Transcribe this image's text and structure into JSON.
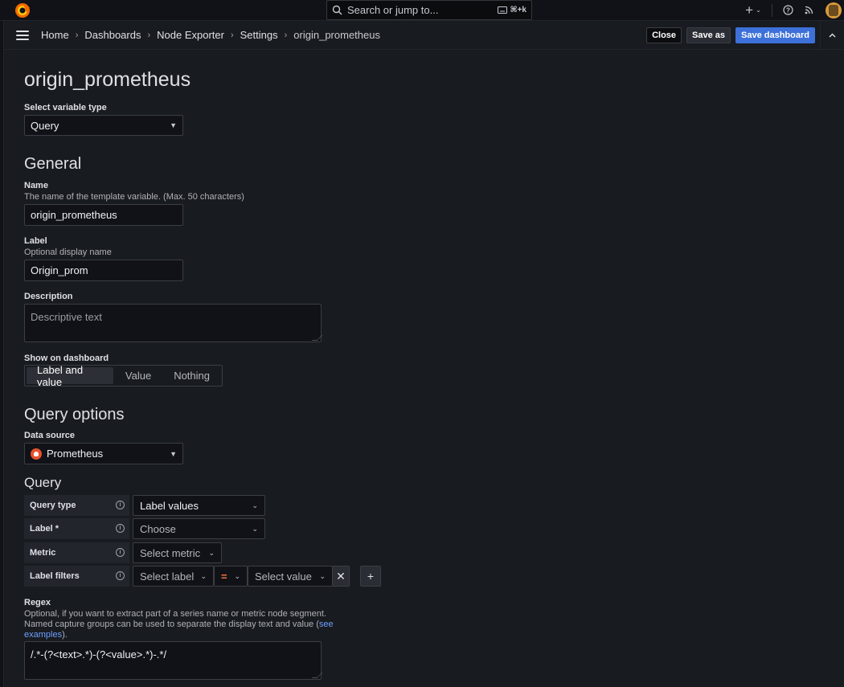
{
  "search": {
    "placeholder": "Search or jump to...",
    "shortcut": "⌘+k"
  },
  "topbar": {
    "add_icon": "plus-icon",
    "help_icon": "help-icon",
    "news_icon": "rss-icon"
  },
  "breadcrumb": [
    "Home",
    "Dashboards",
    "Node Exporter",
    "Settings",
    "origin_prometheus"
  ],
  "toolbar": {
    "close_label": "Close",
    "save_as_label": "Save as",
    "save_dashboard_label": "Save dashboard"
  },
  "page": {
    "title": "origin_prometheus"
  },
  "variable_type": {
    "label": "Select variable type",
    "value": "Query"
  },
  "general": {
    "heading": "General",
    "name": {
      "label": "Name",
      "description": "The name of the template variable. (Max. 50 characters)",
      "value": "origin_prometheus"
    },
    "display_label": {
      "label": "Label",
      "description": "Optional display name",
      "value": "Origin_prom"
    },
    "description": {
      "label": "Description",
      "placeholder": "Descriptive text"
    },
    "show_on_dashboard": {
      "label": "Show on dashboard",
      "options": [
        "Label and value",
        "Value",
        "Nothing"
      ],
      "selected": "Label and value"
    }
  },
  "query_options": {
    "heading": "Query options",
    "data_source": {
      "label": "Data source",
      "value": "Prometheus"
    }
  },
  "query": {
    "heading": "Query",
    "query_type": {
      "label": "Query type",
      "value": "Label values"
    },
    "label": {
      "label": "Label *",
      "placeholder": "Choose"
    },
    "metric": {
      "label": "Metric",
      "placeholder": "Select metric"
    },
    "label_filters": {
      "label": "Label filters",
      "label_placeholder": "Select label",
      "operator": "=",
      "value_placeholder": "Select value"
    }
  },
  "regex": {
    "label": "Regex",
    "description_line1": "Optional, if you want to extract part of a series name or metric node segment.",
    "description_line2": "Named capture groups can be used to separate the display text and value (",
    "link_see": "see",
    "link_examples": "examples",
    "description_end": ").",
    "value": "/.*-(?<text>.*)-(?<value>.*)-.*/"
  },
  "colors": {
    "accent": "#3d71d9",
    "operator": "#ff7a3d",
    "prometheus": "#e6522c"
  }
}
